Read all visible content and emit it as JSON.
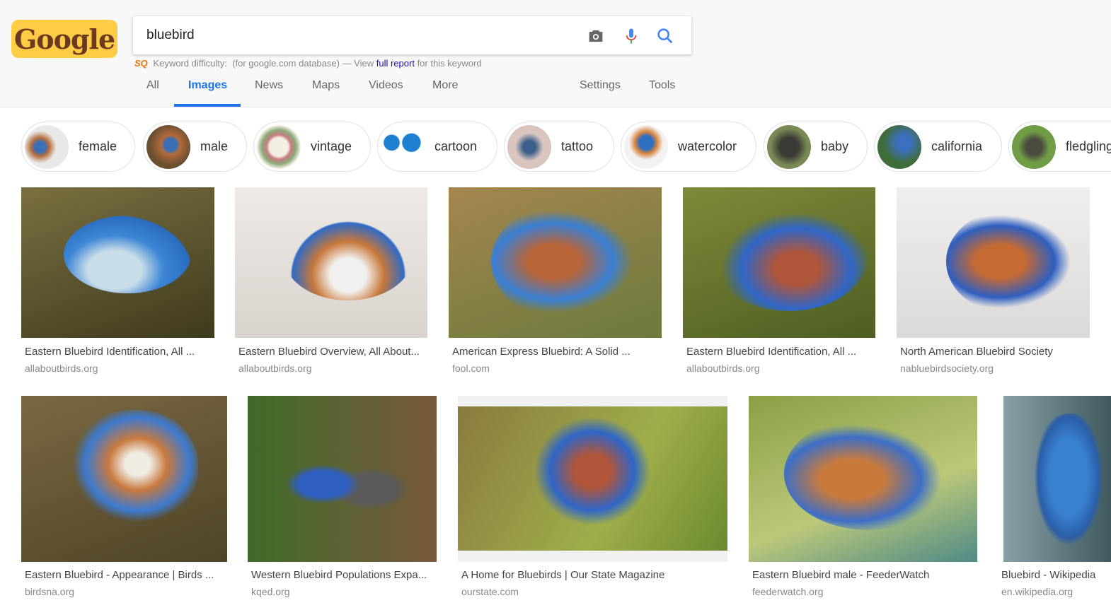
{
  "header": {
    "logo_text": "Google",
    "query": "bluebird",
    "keyword_bar": {
      "badge": "SQ",
      "label": "Keyword difficulty:",
      "db": "(for google.com database) — View",
      "link": "full report",
      "suffix": "for this keyword"
    },
    "tabs": [
      "All",
      "Images",
      "News",
      "Maps",
      "Videos",
      "More"
    ],
    "active_tab": "Images",
    "settings": "Settings",
    "tools": "Tools"
  },
  "chips": [
    "female",
    "male",
    "vintage",
    "cartoon",
    "tattoo",
    "watercolor",
    "baby",
    "california",
    "fledgling"
  ],
  "results": [
    {
      "title": "Eastern Bluebird Identification, All ...",
      "source": "allaboutbirds.org"
    },
    {
      "title": "Eastern Bluebird Overview, All About...",
      "source": "allaboutbirds.org"
    },
    {
      "title": "American Express Bluebird: A Solid ...",
      "source": "fool.com"
    },
    {
      "title": "Eastern Bluebird Identification, All ...",
      "source": "allaboutbirds.org"
    },
    {
      "title": "North American Bluebird Society",
      "source": "nabluebirdsociety.org"
    },
    {
      "title": "Eastern Bluebird - Appearance | Birds ...",
      "source": "birdsna.org"
    },
    {
      "title": "Western Bluebird Populations Expa...",
      "source": "kqed.org"
    },
    {
      "title": "A Home for Bluebirds | Our State Magazine",
      "source": "ourstate.com"
    },
    {
      "title": "Eastern Bluebird male - FeederWatch",
      "source": "feederwatch.org"
    },
    {
      "title": "Bluebird - Wikipedia",
      "source": "en.wikipedia.org"
    }
  ],
  "colors": {
    "accent": "#1a73e8",
    "link": "#1a0dab",
    "logo_bg": "#ffcd45"
  }
}
